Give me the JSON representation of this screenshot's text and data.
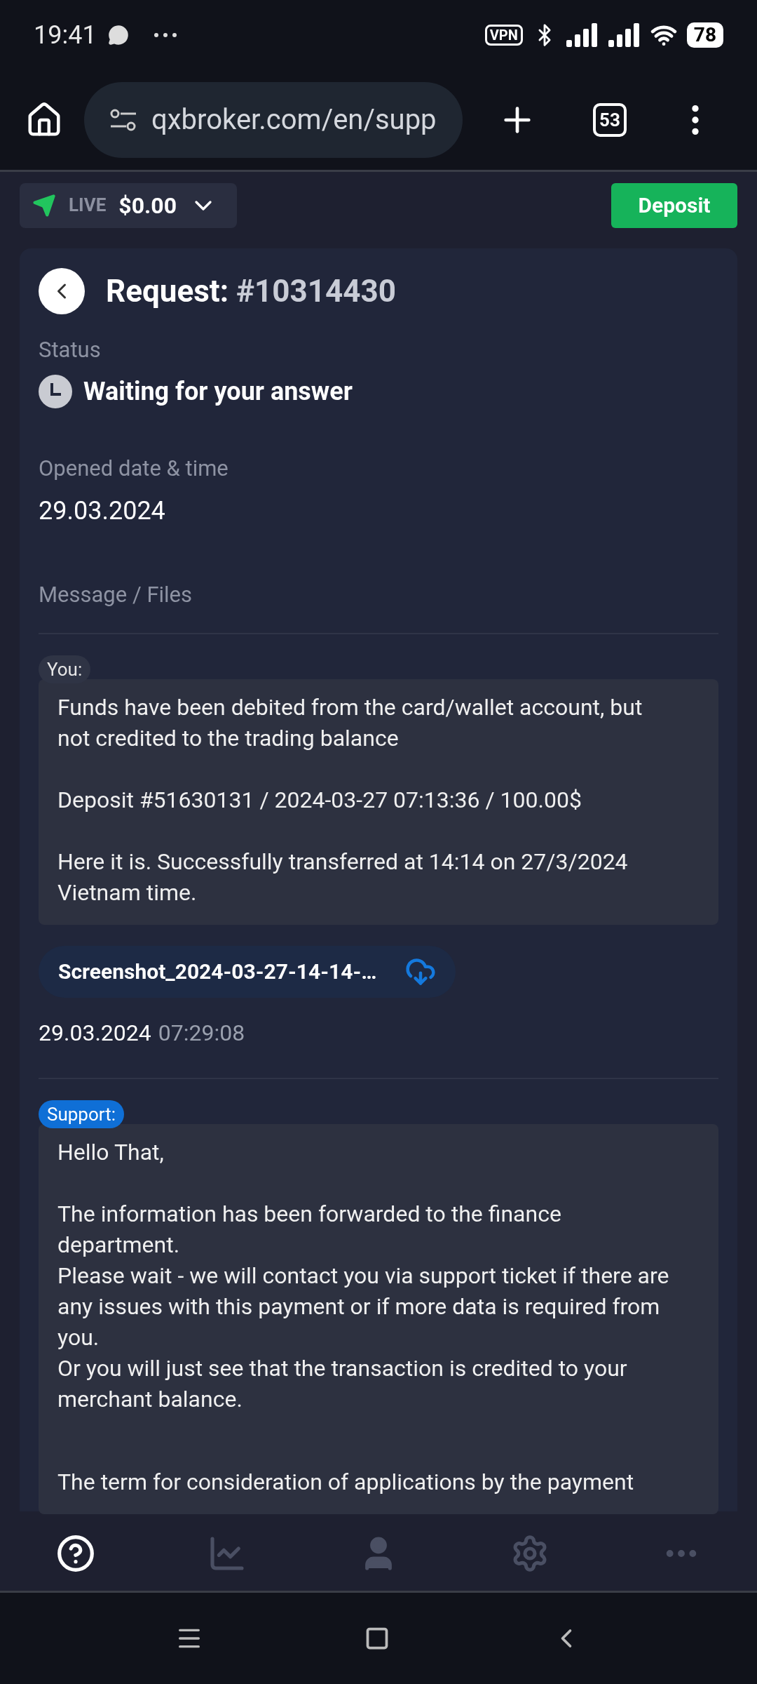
{
  "status_bar": {
    "time": "19:41",
    "vpn": "VPN",
    "battery": "78"
  },
  "browser": {
    "url": "qxbroker.com/en/supp",
    "tab_count": "53"
  },
  "top_bar": {
    "mode": "LIVE",
    "balance": "$0.00",
    "deposit": "Deposit"
  },
  "request": {
    "title": "Request:",
    "number": "#10314430",
    "status_label": "Status",
    "status": "Waiting for your answer",
    "opened_label": "Opened date & time",
    "opened": "29.03.2024",
    "messages_label": "Message / Files"
  },
  "messages": [
    {
      "kind": "user",
      "author": "You:",
      "blocks": [
        [
          "Funds have been debited from the card/wallet account, but not credited to the trading balance"
        ],
        [
          "Deposit #51630131 / 2024-03-27 07:13:36 / 100.00$"
        ],
        [
          "Here it is. Successfully transferred at 14:14 on 27/3/2024 Vietnam time."
        ]
      ],
      "attachment": "Screenshot_2024-03-27-14-14-…",
      "date": "29.03.2024",
      "time": "07:29:08"
    },
    {
      "kind": "support",
      "author": "Support:",
      "blocks": [
        [
          "Hello That,"
        ],
        [
          "The information has been forwarded to the finance department.",
          "Please wait - we will contact you via support ticket if there are any issues with this payment or if more data is required from you.",
          "Or you will just see that the transaction is credited to your merchant balance."
        ],
        [
          "The term for consideration of applications by the payment"
        ]
      ]
    }
  ],
  "nav": [
    {
      "kind": "help",
      "selected": true
    },
    {
      "kind": "chart",
      "selected": false
    },
    {
      "kind": "profile",
      "selected": false
    },
    {
      "kind": "settings",
      "selected": false
    },
    {
      "kind": "more",
      "selected": false
    }
  ]
}
